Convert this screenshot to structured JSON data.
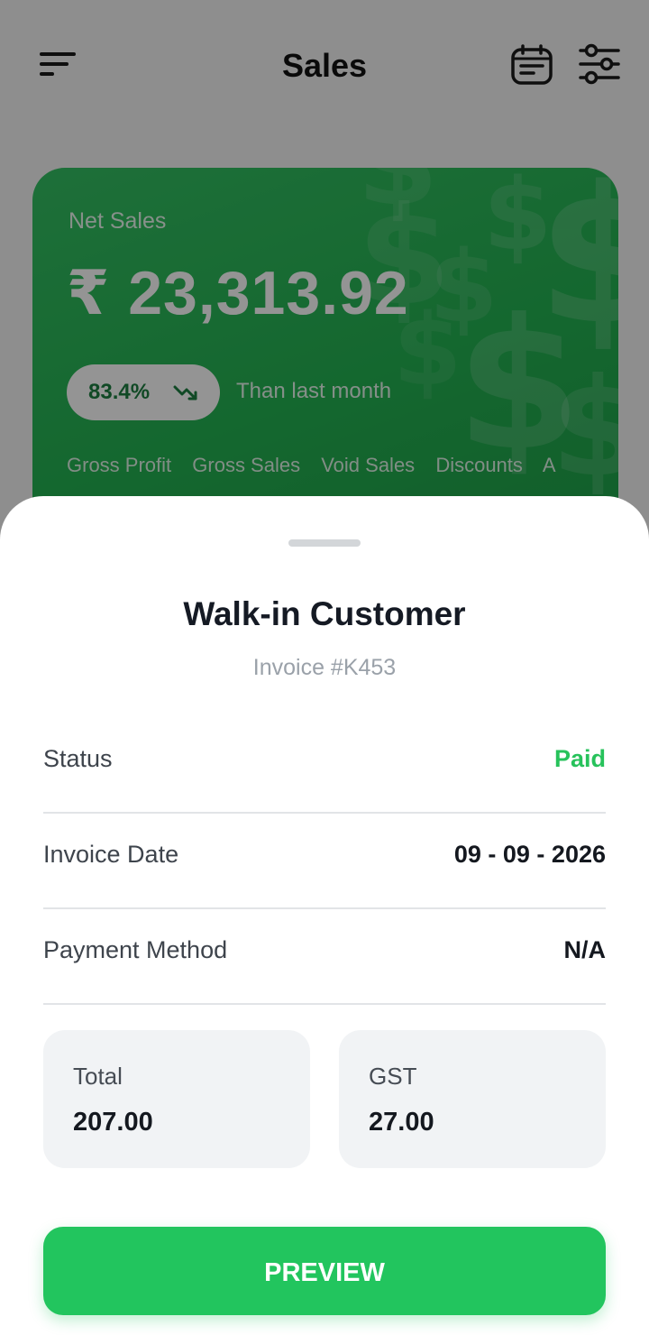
{
  "header": {
    "title": "Sales",
    "menu_icon": "menu-icon",
    "calendar_icon": "calendar-icon",
    "filter_icon": "filter-sliders-icon"
  },
  "sales_card": {
    "label": "Net Sales",
    "amount": "₹ 23,313.92",
    "trend_value": "83.4%",
    "trend_icon": "trend-down-icon",
    "trend_text": "Than last month",
    "metric_tabs": [
      "Gross Profit",
      "Gross Sales",
      "Void Sales",
      "Discounts",
      "A"
    ],
    "accent_color": "#24b352"
  },
  "sheet": {
    "customer_name": "Walk-in Customer",
    "invoice_number": "Invoice #K453",
    "rows": [
      {
        "label": "Status",
        "value": "Paid"
      },
      {
        "label": "Invoice Date",
        "value": "09 - 09 - 2026"
      },
      {
        "label": "Payment Method",
        "value": "N/A"
      }
    ],
    "summary": [
      {
        "label": "Total",
        "value": "207.00"
      },
      {
        "label": "GST",
        "value": "27.00"
      }
    ],
    "preview_label": "PREVIEW",
    "status_color": "#27c25b",
    "button_color": "#22c55e"
  }
}
